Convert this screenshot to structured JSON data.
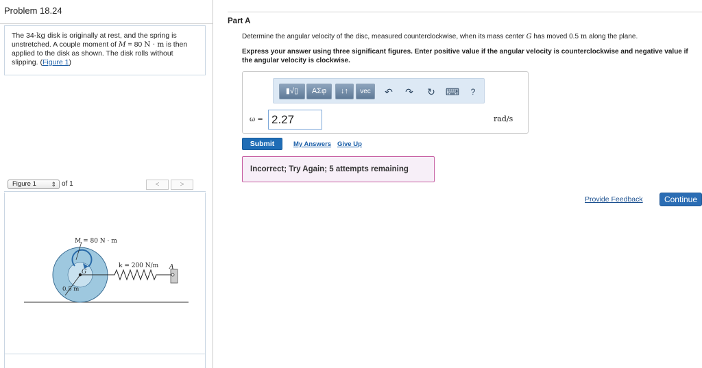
{
  "problem": {
    "title": "Problem 18.24",
    "text_part1": "The 34-",
    "mass_unit": "kg",
    "text_part2": " disk is originally at rest, and the spring is unstretched. A couple moment of ",
    "moment_var": "M",
    "text_part3": " = 80 ",
    "moment_unit": "N · m",
    "text_part4": " is then applied to the disk as shown. The disk rolls without slipping. (",
    "figure_link": "Figure 1",
    "text_part5": ")"
  },
  "figure_nav": {
    "selected": "Figure 1",
    "of_label": "of 1",
    "prev_label": "<",
    "next_label": ">"
  },
  "figure": {
    "moment_label": "M = 80 N · m",
    "spring_label": "k = 200 N/m",
    "center_label": "G",
    "point_label": "A",
    "radius_label": "0.5 m",
    "colors": {
      "disk": "#9ec8df",
      "disk_dark": "#5a8fb2",
      "arrow": "#2a6aa8"
    }
  },
  "part": {
    "title": "Part A",
    "question_part1": "Determine the angular velocity of the disc, measured counterclockwise, when its mass center ",
    "question_var": "G",
    "question_part2": " has moved 0.5 ",
    "question_unit": "m",
    "question_part3": " along the plane.",
    "instructions": "Express your answer using three significant figures. Enter positive value if the angular velocity is counterclockwise and negative value if the angular velocity is clockwise."
  },
  "toolbar": {
    "templates_label": "▮√▯",
    "greek_label": "ΑΣφ",
    "updown_label": "↓↑",
    "vec_label": "vec",
    "undo_icon": "undo-icon",
    "redo_icon": "redo-icon",
    "reset_icon": "reset-icon",
    "keyboard_icon": "keyboard-icon",
    "help_label": "?"
  },
  "answer": {
    "variable": "ω =",
    "value": "2.27",
    "units": "rad/s"
  },
  "actions": {
    "submit": "Submit",
    "my_answers": "My Answers",
    "give_up": "Give Up"
  },
  "feedback": {
    "message": "Incorrect; Try Again; 5 attempts remaining",
    "border_color": "#c55ba0"
  },
  "footer": {
    "provide_feedback": "Provide Feedback",
    "continue": "Continue"
  }
}
